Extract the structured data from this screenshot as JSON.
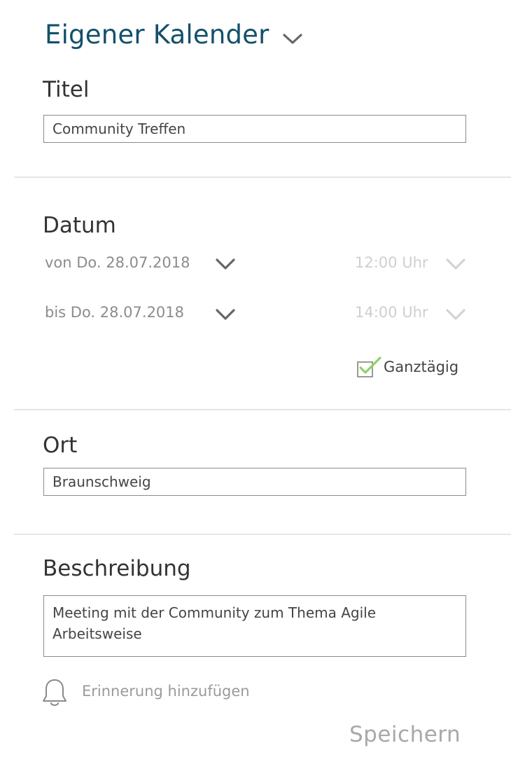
{
  "calendar": {
    "selected": "Eigener Kalender",
    "chevron_icon": "chevron-down-icon"
  },
  "title_section": {
    "label": "Titel",
    "value": "Community Treffen"
  },
  "date_section": {
    "label": "Datum",
    "from": {
      "date": "von Do. 28.07.2018",
      "time": "12:00 Uhr"
    },
    "to": {
      "date": "bis Do. 28.07.2018",
      "time": "14:00 Uhr"
    },
    "all_day": {
      "label": "Ganztägig",
      "checked": true,
      "check_color": "#8fd16a"
    }
  },
  "location_section": {
    "label": "Ort",
    "value": "Braunschweig"
  },
  "description_section": {
    "label": "Beschreibung",
    "value": "Meeting mit der Community zum Thema Agile Arbeitsweise"
  },
  "reminder": {
    "label": "Erinnerung hinzufügen",
    "icon": "bell-icon"
  },
  "save_label": "Speichern",
  "colors": {
    "accent": "#13506b",
    "muted_text": "#8c8c8c",
    "disabled_text": "#cfcfcf",
    "checkmark": "#8fd16a"
  }
}
